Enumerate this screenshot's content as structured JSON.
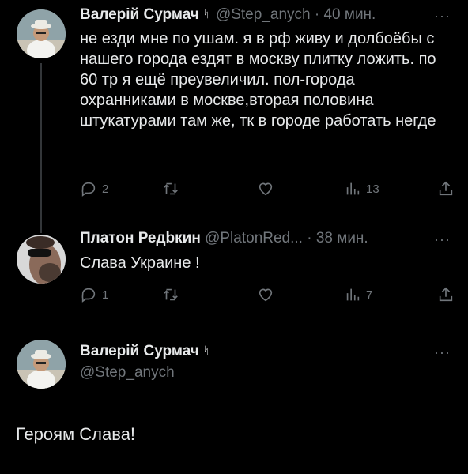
{
  "tweets": [
    {
      "name": "Валерій Сурмач",
      "badge": "ᛋ",
      "handle": "@Step_anych",
      "time": "40 мин.",
      "text": "не езди мне по ушам. я в рф живу и долбоёбы с нашего города  ездят в москву плитку ложить. по 60 тр я ещё преувеличил. пол-города охранниками в москве,вторая половина штукатурами там же, тк в городе работать негде",
      "replies": "2",
      "retweets": "",
      "likes": "",
      "views": "13"
    },
    {
      "name": "Платон Редbкин",
      "handle": "@PlatonRed...",
      "time": "38 мин.",
      "text": "Слава Украине !",
      "replies": "1",
      "retweets": "",
      "likes": "",
      "views": "7"
    }
  ],
  "main": {
    "name": "Валерій Сурмач",
    "badge": "ᛋ",
    "handle": "@Step_anych",
    "text": "Героям Слава!"
  },
  "more_label": "···",
  "dot": "·",
  "icons": [
    "reply-icon",
    "retweet-icon",
    "like-icon",
    "views-icon",
    "share-icon"
  ]
}
